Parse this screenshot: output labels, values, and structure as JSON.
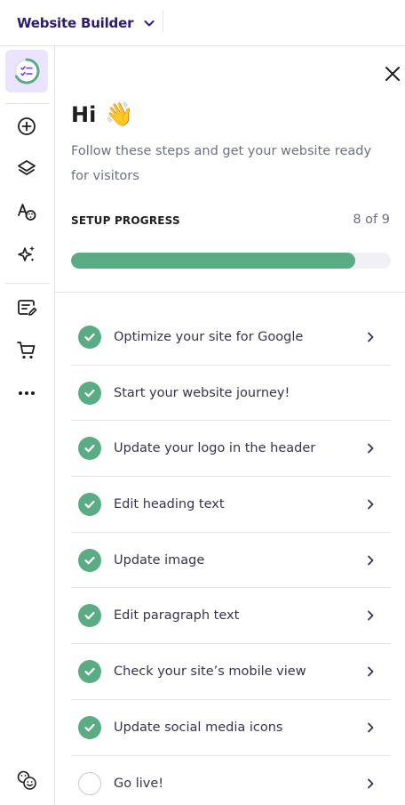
{
  "topbar": {
    "app_title": "Website Builder"
  },
  "panel": {
    "greeting": "Hi",
    "greeting_emoji": "👋",
    "subtitle": "Follow these steps and get your website ready for visitors",
    "progress_label": "SETUP PROGRESS",
    "progress_count": "8 of 9",
    "progress_fraction": 0.889
  },
  "steps": [
    {
      "label": "Optimize your site for Google",
      "done": true,
      "has_arrow": true
    },
    {
      "label": "Start your website journey!",
      "done": true,
      "has_arrow": false
    },
    {
      "label": "Update your logo in the header",
      "done": true,
      "has_arrow": true
    },
    {
      "label": "Edit heading text",
      "done": true,
      "has_arrow": true
    },
    {
      "label": "Update image",
      "done": true,
      "has_arrow": true
    },
    {
      "label": "Edit paragraph text",
      "done": true,
      "has_arrow": true
    },
    {
      "label": "Check your site’s mobile view",
      "done": true,
      "has_arrow": true
    },
    {
      "label": "Update social media icons",
      "done": true,
      "has_arrow": true
    },
    {
      "label": "Go live!",
      "done": false,
      "has_arrow": true
    }
  ],
  "rail": {
    "items": [
      "checklist-icon",
      "add-icon",
      "layers-icon",
      "styles-icon",
      "ai-sparkle-icon",
      "blog-icon",
      "store-cart-icon",
      "more-icon",
      "accessibility-icon"
    ]
  },
  "colors": {
    "accent_purple": "#673de6",
    "active_bg": "#ebe4ff",
    "success_green": "#5bac84",
    "title_navy": "#2f1c6a"
  }
}
